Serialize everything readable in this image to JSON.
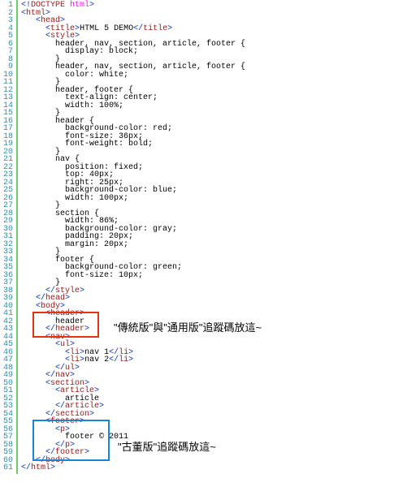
{
  "line_count": 61,
  "lines": [
    [
      [
        "t-blue",
        "<!"
      ],
      [
        "t-red",
        "DOCTYPE"
      ],
      [
        "t-blue",
        " "
      ],
      [
        "t-pink",
        "html"
      ],
      [
        "t-blue",
        ">"
      ]
    ],
    [
      [
        "t-blue",
        "<"
      ],
      [
        "t-red",
        "html"
      ],
      [
        "t-blue",
        ">"
      ]
    ],
    [
      [
        "",
        ".  "
      ],
      [
        "t-blue",
        "<"
      ],
      [
        "t-red",
        "head"
      ],
      [
        "t-blue",
        ">"
      ]
    ],
    [
      [
        "",
        ".    "
      ],
      [
        "t-blue",
        "<"
      ],
      [
        "t-red",
        "title"
      ],
      [
        "t-blue",
        ">"
      ],
      [
        "",
        "HTML 5 DEMO"
      ],
      [
        "t-blue",
        "</"
      ],
      [
        "t-red",
        "title"
      ],
      [
        "t-blue",
        ">"
      ]
    ],
    [
      [
        "",
        ".    "
      ],
      [
        "t-blue",
        "<"
      ],
      [
        "t-red",
        "style"
      ],
      [
        "t-blue",
        ">"
      ]
    ],
    [
      [
        "",
        ".      header, nav, section, article, footer {"
      ]
    ],
    [
      [
        "",
        ".        display: block;"
      ]
    ],
    [
      [
        "",
        ".      }"
      ]
    ],
    [
      [
        "",
        ".      header, nav, section, article, footer {"
      ]
    ],
    [
      [
        "",
        ".        color: white;"
      ]
    ],
    [
      [
        "",
        ".      }"
      ]
    ],
    [
      [
        "",
        ".      header, footer {"
      ]
    ],
    [
      [
        "",
        ".        text-align: center;"
      ]
    ],
    [
      [
        "",
        ".        width: 100%;"
      ]
    ],
    [
      [
        "",
        ".      }"
      ]
    ],
    [
      [
        "",
        ".      header {"
      ]
    ],
    [
      [
        "",
        ".        background-color: red;"
      ]
    ],
    [
      [
        "",
        ".        font-size: 36px;"
      ]
    ],
    [
      [
        "",
        ".        font-weight: bold;"
      ]
    ],
    [
      [
        "",
        ".      }"
      ]
    ],
    [
      [
        "",
        ".      nav {"
      ]
    ],
    [
      [
        "",
        ".        position: fixed;"
      ]
    ],
    [
      [
        "",
        ".        top: 40px;"
      ]
    ],
    [
      [
        "",
        ".        right: 25px;"
      ]
    ],
    [
      [
        "",
        ".        background-color: blue;"
      ]
    ],
    [
      [
        "",
        ".        width: 100px;"
      ]
    ],
    [
      [
        "",
        ".      }"
      ]
    ],
    [
      [
        "",
        ".      section {"
      ]
    ],
    [
      [
        "",
        ".        width: 86%;"
      ]
    ],
    [
      [
        "",
        ".        background-color: gray;"
      ]
    ],
    [
      [
        "",
        ".        padding: 20px;"
      ]
    ],
    [
      [
        "",
        ".        margin: 20px;"
      ]
    ],
    [
      [
        "",
        ".      }"
      ]
    ],
    [
      [
        "",
        ".      footer {"
      ]
    ],
    [
      [
        "",
        ".        background-color: green;"
      ]
    ],
    [
      [
        "",
        ".        font-size: 10px;"
      ]
    ],
    [
      [
        "",
        ".      }"
      ]
    ],
    [
      [
        "",
        ".    "
      ],
      [
        "t-blue",
        "</"
      ],
      [
        "t-red",
        "style"
      ],
      [
        "t-blue",
        ">"
      ]
    ],
    [
      [
        "",
        ".  "
      ],
      [
        "t-blue",
        "</"
      ],
      [
        "t-red",
        "head"
      ],
      [
        "t-blue",
        ">"
      ]
    ],
    [
      [
        "",
        ".  "
      ],
      [
        "t-blue",
        "<"
      ],
      [
        "t-red",
        "body"
      ],
      [
        "t-blue",
        ">"
      ]
    ],
    [
      [
        "",
        ".    "
      ],
      [
        "t-blue",
        "<"
      ],
      [
        "t-red",
        "header"
      ],
      [
        "t-blue",
        ">"
      ]
    ],
    [
      [
        "",
        ".      header"
      ]
    ],
    [
      [
        "",
        ".    "
      ],
      [
        "t-blue",
        "</"
      ],
      [
        "t-red",
        "header"
      ],
      [
        "t-blue",
        ">"
      ]
    ],
    [
      [
        "",
        ".    "
      ],
      [
        "t-blue",
        "<"
      ],
      [
        "t-red",
        "nav"
      ],
      [
        "t-blue",
        ">"
      ]
    ],
    [
      [
        "",
        ".      "
      ],
      [
        "t-blue",
        "<"
      ],
      [
        "t-red",
        "ul"
      ],
      [
        "t-blue",
        ">"
      ]
    ],
    [
      [
        "",
        ".        "
      ],
      [
        "t-blue",
        "<"
      ],
      [
        "t-red",
        "li"
      ],
      [
        "t-blue",
        ">"
      ],
      [
        "",
        "nav 1"
      ],
      [
        "t-blue",
        "</"
      ],
      [
        "t-red",
        "li"
      ],
      [
        "t-blue",
        ">"
      ]
    ],
    [
      [
        "",
        ".        "
      ],
      [
        "t-blue",
        "<"
      ],
      [
        "t-red",
        "li"
      ],
      [
        "t-blue",
        ">"
      ],
      [
        "",
        "nav 2"
      ],
      [
        "t-blue",
        "</"
      ],
      [
        "t-red",
        "li"
      ],
      [
        "t-blue",
        ">"
      ]
    ],
    [
      [
        "",
        ".      "
      ],
      [
        "t-blue",
        "</"
      ],
      [
        "t-red",
        "ul"
      ],
      [
        "t-blue",
        ">"
      ]
    ],
    [
      [
        "",
        ".    "
      ],
      [
        "t-blue",
        "</"
      ],
      [
        "t-red",
        "nav"
      ],
      [
        "t-blue",
        ">"
      ]
    ],
    [
      [
        "",
        ".    "
      ],
      [
        "t-blue",
        "<"
      ],
      [
        "t-red",
        "section"
      ],
      [
        "t-blue",
        ">"
      ]
    ],
    [
      [
        "",
        ".      "
      ],
      [
        "t-blue",
        "<"
      ],
      [
        "t-red",
        "article"
      ],
      [
        "t-blue",
        ">"
      ]
    ],
    [
      [
        "",
        ".        article"
      ]
    ],
    [
      [
        "",
        ".      "
      ],
      [
        "t-blue",
        "</"
      ],
      [
        "t-red",
        "article"
      ],
      [
        "t-blue",
        ">"
      ]
    ],
    [
      [
        "",
        ".    "
      ],
      [
        "t-blue",
        "</"
      ],
      [
        "t-red",
        "section"
      ],
      [
        "t-blue",
        ">"
      ]
    ],
    [
      [
        "",
        ".    "
      ],
      [
        "t-blue",
        "<"
      ],
      [
        "t-red",
        "footer"
      ],
      [
        "t-blue",
        ">"
      ]
    ],
    [
      [
        "",
        ".      "
      ],
      [
        "t-blue",
        "<"
      ],
      [
        "t-red",
        "p"
      ],
      [
        "t-blue",
        ">"
      ]
    ],
    [
      [
        "",
        ".        footer © 2011"
      ]
    ],
    [
      [
        "",
        ".      "
      ],
      [
        "t-blue",
        "</"
      ],
      [
        "t-red",
        "p"
      ],
      [
        "t-blue",
        ">"
      ]
    ],
    [
      [
        "",
        ".    "
      ],
      [
        "t-blue",
        "</"
      ],
      [
        "t-red",
        "footer"
      ],
      [
        "t-blue",
        ">"
      ]
    ],
    [
      [
        "",
        ".  "
      ],
      [
        "t-blue",
        "</"
      ],
      [
        "t-red",
        "body"
      ],
      [
        "t-blue",
        ">"
      ]
    ],
    [
      [
        "t-blue",
        "</"
      ],
      [
        "t-red",
        "html"
      ],
      [
        "t-blue",
        ">"
      ]
    ]
  ],
  "annotations": {
    "top": "\"傳統版\"與\"通用版\"追蹤碼放這~",
    "bottom": "\"古董版\"追蹤碼放這~"
  }
}
